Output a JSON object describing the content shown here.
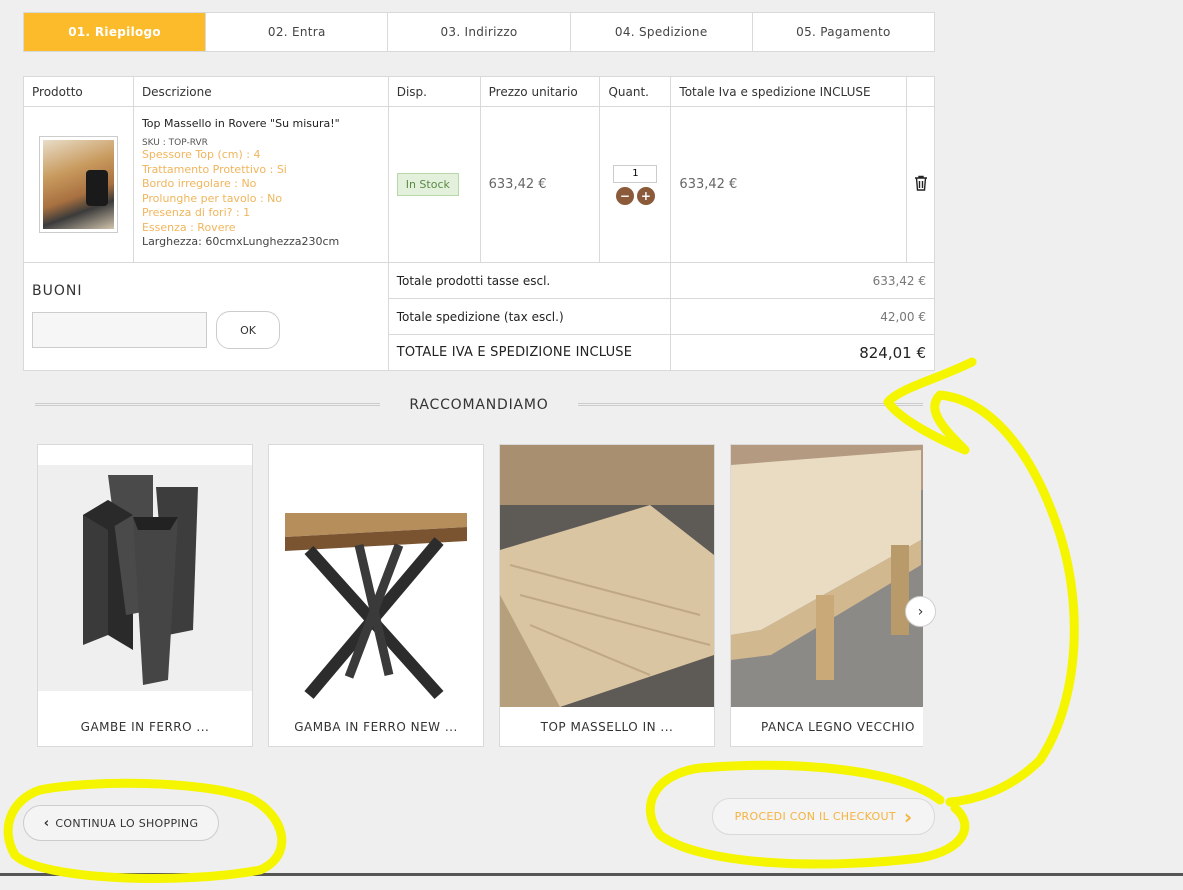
{
  "steps": [
    "01. Riepilogo",
    "02. Entra",
    "03. Indirizzo",
    "04. Spedizione",
    "05. Pagamento"
  ],
  "table": {
    "headers": [
      "Prodotto",
      "Descrizione",
      "Disp.",
      "Prezzo unitario",
      "Quant.",
      "Totale Iva e spedizione INCLUSE"
    ],
    "item": {
      "name": "Top Massello in Rovere \"Su misura!\"",
      "sku": "SKU : TOP-RVR",
      "attributes": [
        "Spessore Top (cm) : 4",
        "Trattamento Protettivo : Si",
        "Bordo irregolare : No",
        "Prolunghe per tavolo : No",
        "Presenza di fori? : 1",
        "Essenza : Rovere"
      ],
      "size": "Larghezza: 60cmxLunghezza230cm",
      "availability": "In Stock",
      "unit_price": "633,42 €",
      "quantity": "1",
      "total": "633,42 €"
    }
  },
  "voucher": {
    "title": "BUONI",
    "ok_label": "OK"
  },
  "summary": {
    "products_label": "Totale prodotti tasse escl.",
    "products_value": "633,42 €",
    "shipping_label": "Totale spedizione (tax escl.)",
    "shipping_value": "42,00 €",
    "total_label": "TOTALE IVA E SPEDIZIONE INCLUSE",
    "total_value": "824,01 €"
  },
  "recommend": {
    "title": "RACCOMANDIAMO",
    "products": [
      "GAMBE IN FERRO ...",
      "GAMBA IN FERRO NEW ...",
      "TOP MASSELLO IN ...",
      "PANCA LEGNO VECCHIO"
    ]
  },
  "buttons": {
    "continue": "CONTINUA LO SHOPPING",
    "checkout": "PROCEDI CON IL CHECKOUT"
  },
  "colors": {
    "accent": "#fbbb2b",
    "annotation": "#f5f500",
    "qty_button": "#8a5a3a"
  },
  "icons": {
    "trash": "trash-icon",
    "chevron_left": "chevron-left-icon",
    "chevron_right": "chevron-right-icon"
  }
}
